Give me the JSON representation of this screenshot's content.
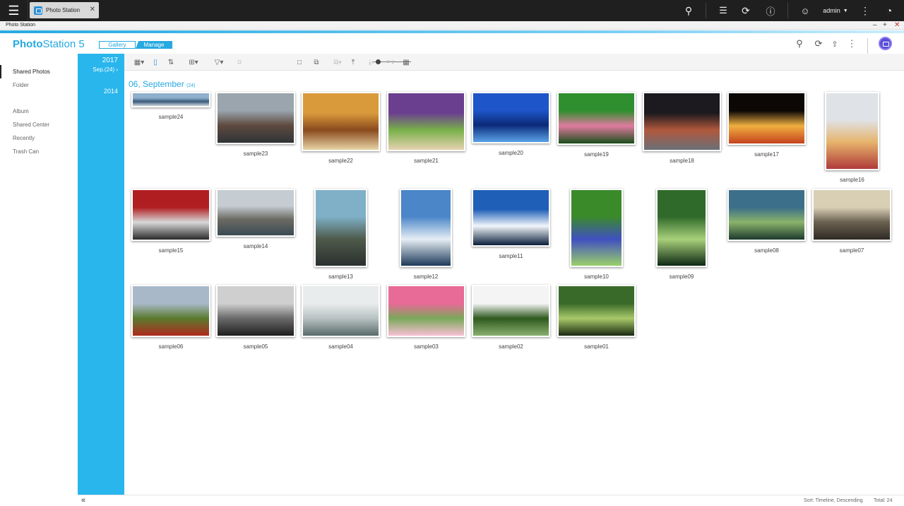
{
  "topbar": {
    "tab_title": "Photo Station",
    "user": "admin"
  },
  "window": {
    "title": "Photo Station"
  },
  "app": {
    "brand_bold": "Photo",
    "brand_rest": "Station 5",
    "view_gallery": "Gallery",
    "view_manage": "Manage"
  },
  "sidebar": {
    "items": [
      {
        "label": "Shared Photos"
      },
      {
        "label": "Folder"
      },
      {
        "label": "Album"
      },
      {
        "label": "Shared Center"
      },
      {
        "label": "Recently"
      },
      {
        "label": "Trash Can"
      }
    ]
  },
  "timeline": {
    "year1": "2017",
    "month": "Sep.(24)",
    "year2": "2014"
  },
  "group": {
    "date": "06, September",
    "count": "(24)"
  },
  "photos": [
    {
      "name": "sample24",
      "colors": [
        "#8fb0cc",
        "#3a5a7a",
        "#cfd7de"
      ]
    },
    {
      "name": "sample23",
      "colors": [
        "#9aa5ad",
        "#5e4a3f",
        "#2f3438"
      ]
    },
    {
      "name": "sample22",
      "colors": [
        "#d99a3c",
        "#8a4a1c",
        "#e8d4a6"
      ]
    },
    {
      "name": "sample21",
      "colors": [
        "#6b3f8f",
        "#78b04a",
        "#e7d2b0"
      ]
    },
    {
      "name": "sample20",
      "colors": [
        "#1e55c8",
        "#0b2a78",
        "#5aa2e8"
      ]
    },
    {
      "name": "sample19",
      "colors": [
        "#2f8f2e",
        "#e07aa0",
        "#1a4f1a"
      ]
    },
    {
      "name": "sample18",
      "colors": [
        "#1c1a1e",
        "#b0583c",
        "#6a6f78"
      ]
    },
    {
      "name": "sample17",
      "colors": [
        "#0c0806",
        "#f0b040",
        "#c4421e"
      ]
    },
    {
      "name": "sample16",
      "colors": [
        "#dfe3e8",
        "#e6b36a",
        "#b03a3a"
      ]
    },
    {
      "name": "sample15",
      "colors": [
        "#b01e22",
        "#d8d8d8",
        "#2a2a2a"
      ]
    },
    {
      "name": "sample14",
      "colors": [
        "#c5ccd2",
        "#6a6a62",
        "#3b4a55"
      ]
    },
    {
      "name": "sample13",
      "colors": [
        "#7fb0c8",
        "#4e5a4a",
        "#2b3030"
      ]
    },
    {
      "name": "sample12",
      "colors": [
        "#4a86c8",
        "#e6eef4",
        "#1e3a5a"
      ]
    },
    {
      "name": "sample11",
      "colors": [
        "#1f5fb8",
        "#f2f6fa",
        "#0a1e3a"
      ]
    },
    {
      "name": "sample10",
      "colors": [
        "#3a8a2a",
        "#4050c0",
        "#9ad06a"
      ]
    },
    {
      "name": "sample09",
      "colors": [
        "#2f6a2a",
        "#a8d07a",
        "#0e2a14"
      ]
    },
    {
      "name": "sample08",
      "colors": [
        "#3b6f8a",
        "#8ab36a",
        "#1e3a2e"
      ]
    },
    {
      "name": "sample07",
      "colors": [
        "#d8cfb5",
        "#6a6050",
        "#2e2a24"
      ]
    },
    {
      "name": "sample06",
      "colors": [
        "#a8b8c8",
        "#5a7a2e",
        "#b02a1e"
      ]
    },
    {
      "name": "sample05",
      "colors": [
        "#cfcfcf",
        "#6a6a6a",
        "#1e1e1e"
      ]
    },
    {
      "name": "sample04",
      "colors": [
        "#e8ecec",
        "#b8c2c2",
        "#5a6a6a"
      ]
    },
    {
      "name": "sample03",
      "colors": [
        "#e86a96",
        "#7aa85a",
        "#f8c0d4"
      ]
    },
    {
      "name": "sample02",
      "colors": [
        "#f4f4f4",
        "#2e5a1e",
        "#8ab070"
      ]
    },
    {
      "name": "sample01",
      "colors": [
        "#3a6a2a",
        "#a8c86a",
        "#1a2a10"
      ]
    }
  ],
  "footer": {
    "sort": "Sort: Timeline, Descending",
    "total": "Total: 24"
  }
}
